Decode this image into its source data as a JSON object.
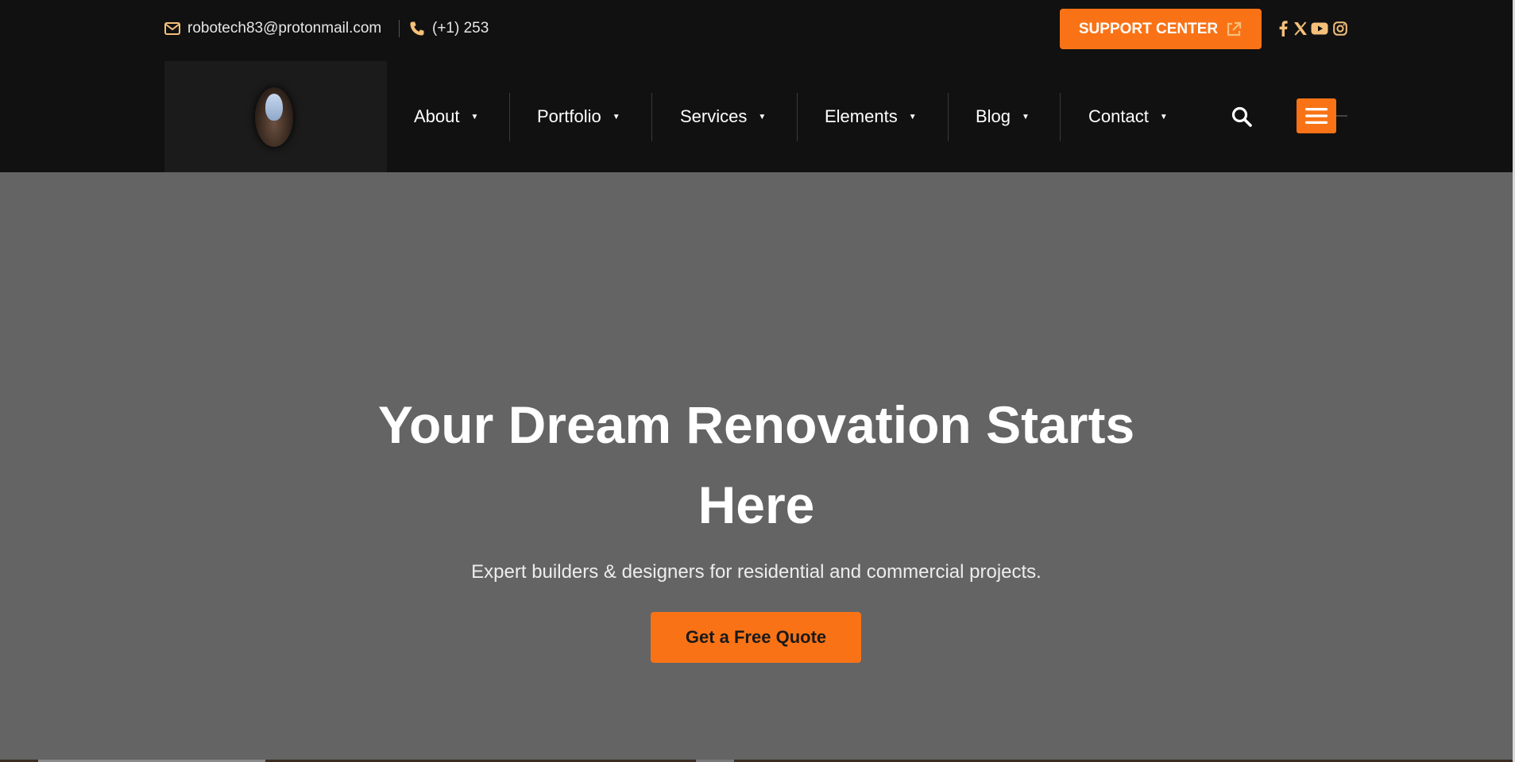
{
  "topbar": {
    "email": "robotech83@protonmail.com",
    "phone": "(+1) 253",
    "support_label": "SUPPORT CENTER",
    "social_icons": [
      "facebook-icon",
      "x-icon",
      "youtube-icon",
      "instagram-icon"
    ]
  },
  "nav": {
    "items": [
      {
        "label": "About"
      },
      {
        "label": "Portfolio"
      },
      {
        "label": "Services"
      },
      {
        "label": "Elements"
      },
      {
        "label": "Blog"
      },
      {
        "label": "Contact"
      }
    ],
    "caret": "▼"
  },
  "hero": {
    "title_line1": "Your Dream Renovation Starts",
    "title_line2": "Here",
    "subtitle": "Expert builders & designers for residential and commercial projects.",
    "cta_label": "Get a Free Quote"
  },
  "colors": {
    "accent": "#f97316",
    "header_bg": "#111111",
    "hero_bg": "#646464",
    "icon_gold": "#f5c07a"
  }
}
